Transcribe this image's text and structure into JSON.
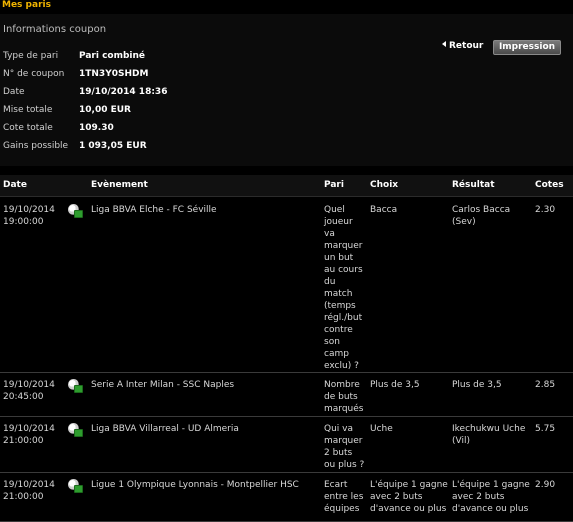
{
  "header": {
    "title": "Mes paris"
  },
  "coupon": {
    "section_title": "Informations coupon",
    "back_label": "Retour",
    "print_label": "Impression",
    "fields": [
      {
        "label": "Type de pari",
        "value": "Pari combiné"
      },
      {
        "label": "N° de coupon",
        "value": "1TN3Y0SHDM"
      },
      {
        "label": "Date",
        "value": "19/10/2014 18:36"
      },
      {
        "label": "Mise totale",
        "value": "10,00 EUR"
      },
      {
        "label": "Cote totale",
        "value": "109.30"
      },
      {
        "label": "Gains possible",
        "value": "1 093,05 EUR"
      }
    ]
  },
  "table": {
    "columns": [
      "Date",
      "Evènement",
      "Pari",
      "Choix",
      "Résultat",
      "Cotes"
    ],
    "rows": [
      {
        "date": "19/10/2014 19:00:00",
        "event": "Liga BBVA Elche - FC Séville",
        "pari": "Quel joueur va marquer un but au cours du match (temps régl./but contre son camp exclu) ?",
        "choix": "Bacca",
        "resultat": "Carlos Bacca (Sev)",
        "cote": "2.30",
        "icon": "soccer-ball-icon"
      },
      {
        "date": "19/10/2014 20:45:00",
        "event": "Serie A Inter Milan - SSC Naples",
        "pari": "Nombre de buts marqués",
        "choix": "Plus de 3,5",
        "resultat": "Plus de 3,5",
        "cote": "2.85",
        "icon": "soccer-ball-icon"
      },
      {
        "date": "19/10/2014 21:00:00",
        "event": "Liga BBVA Villarreal - UD Almeria",
        "pari": "Qui va marquer 2 buts ou plus ?",
        "choix": "Uche",
        "resultat": "Ikechukwu Uche (Vil)",
        "cote": "5.75",
        "icon": "soccer-ball-icon"
      },
      {
        "date": "19/10/2014 21:00:00",
        "event": "Ligue 1 Olympique Lyonnais - Montpellier HSC",
        "pari": "Ecart entre les équipes",
        "choix": "L'équipe 1 gagne avec 2 buts d'avance ou plus",
        "resultat": "L'équipe 1 gagne avec 2 buts d'avance ou plus",
        "cote": "2.90",
        "icon": "soccer-ball-icon"
      }
    ]
  },
  "colors": {
    "accent": "#f0b400",
    "background": "#000000",
    "text": "#d8d8d8"
  }
}
